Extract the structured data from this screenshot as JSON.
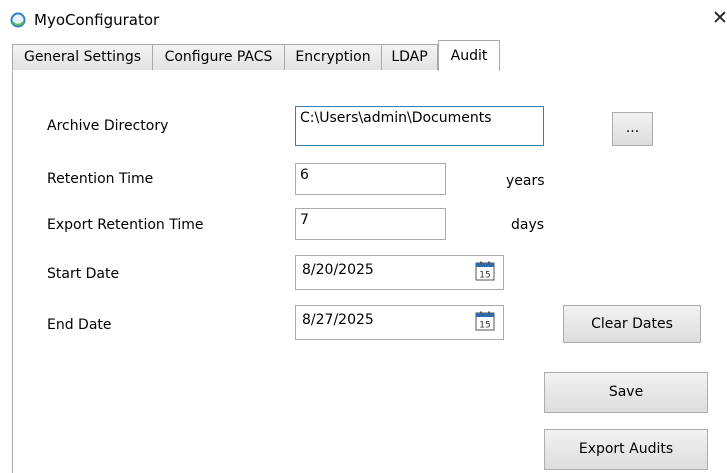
{
  "window": {
    "title": "MyoConfigurator",
    "close_glyph": "✕"
  },
  "tabs": [
    {
      "label": "General Settings"
    },
    {
      "label": "Configure PACS"
    },
    {
      "label": "Encryption"
    },
    {
      "label": "LDAP"
    },
    {
      "label": "Audit",
      "active": true
    }
  ],
  "form": {
    "archive_directory": {
      "label": "Archive Directory",
      "value": "C:\\Users\\admin\\Documents",
      "browse_label": "..."
    },
    "retention_time": {
      "label": "Retention Time",
      "value": "6",
      "unit": "years"
    },
    "export_retention_time": {
      "label": "Export Retention Time",
      "value": "7",
      "unit": "days"
    },
    "start_date": {
      "label": "Start Date",
      "value": "8/20/2025",
      "calendar_day": "15"
    },
    "end_date": {
      "label": "End Date",
      "value": "8/27/2025",
      "calendar_day": "15"
    }
  },
  "buttons": {
    "clear_dates": "Clear Dates",
    "save": "Save",
    "export_audits": "Export Audits"
  },
  "colors": {
    "focus_border": "#3c7fb1",
    "calendar_accent": "#2b6cb0"
  }
}
